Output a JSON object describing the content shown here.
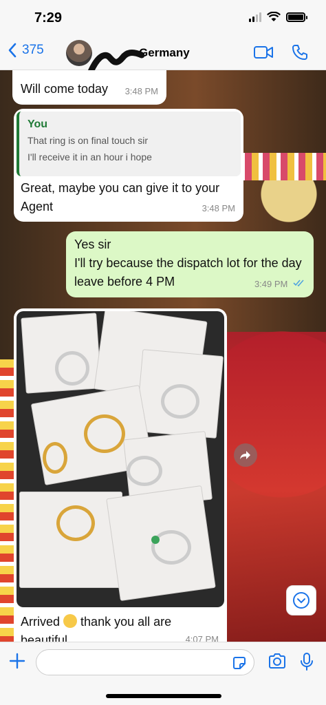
{
  "status": {
    "time": "7:29"
  },
  "header": {
    "back_count": "375",
    "contact_name": "Germany"
  },
  "messages": [
    {
      "type": "incoming",
      "text": "Will come today",
      "time": "3:48 PM"
    },
    {
      "type": "incoming",
      "quote_author": "You",
      "quote_line1": "That ring is on final touch sir",
      "quote_line2": "I'll receive it in an hour i hope",
      "text": "Great, maybe you can give it to your Agent",
      "time": "3:48 PM"
    },
    {
      "type": "outgoing",
      "line1": "Yes sir",
      "line2": "I'll try because the dispatch lot for the day leave before 4 PM",
      "time": "3:49 PM",
      "status": "read"
    },
    {
      "type": "incoming",
      "caption_before": "Arrived",
      "caption_after": "thank you all are beautiful",
      "time": "4:07 PM"
    }
  ],
  "icons": {
    "back": "chevron-left-icon",
    "video": "video-call-icon",
    "phone": "phone-icon",
    "plus": "plus-icon",
    "sticker": "sticker-icon",
    "camera": "camera-icon",
    "mic": "microphone-icon",
    "forward": "forward-icon",
    "scroll": "chevron-down-icon"
  },
  "colors": {
    "accent": "#1a73e8",
    "outgoing_bubble": "#dcf8c6",
    "quote_author": "#1f7a36"
  }
}
